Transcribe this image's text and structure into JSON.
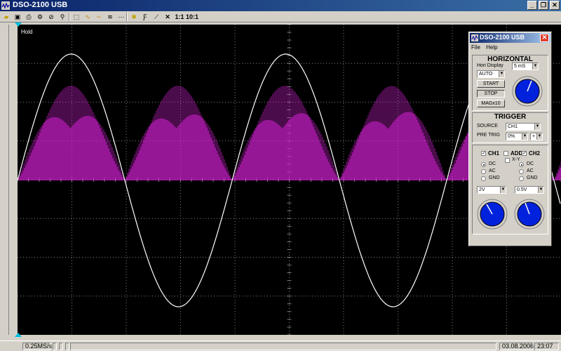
{
  "window": {
    "title": "DSO-2100 USB"
  },
  "toolbar": {
    "ratio1": "1:1",
    "ratio10": "10:1"
  },
  "scope": {
    "status_label": "Hold",
    "colors": {
      "ch1": "#ffffff",
      "ch2": "#d020d0",
      "grid": "#808080",
      "background": "#000000"
    }
  },
  "statusbar": {
    "sample_rate": "0.25MS/s",
    "date": "03.08.2006",
    "time": "23:07"
  },
  "panel": {
    "title": "DSO-2100 USB",
    "menu": [
      "File",
      "Help"
    ],
    "horizontal": {
      "title": "HORIZONTAL",
      "hori_display_label": "Hori Display",
      "hori_display_value": "AUTO",
      "timebase": "5 mS",
      "start_label": "START",
      "stop_label": "STOP",
      "mag_label": "MAGx10"
    },
    "trigger": {
      "title": "TRIGGER",
      "source_label": "SOURCE",
      "source_value": "CH1",
      "pretrig_label": "PRE TRIG",
      "pretrig_value": "0%",
      "slope_value": "+"
    },
    "vertical": {
      "ch1_label": "CH1",
      "add_label": "ADD",
      "xy_label": "X-Y",
      "ch2_label": "CH2",
      "coupling": [
        "DC",
        "AC",
        "GND"
      ],
      "ch1_coupling": "DC",
      "ch2_coupling": "DC",
      "ch1_volts": "2V",
      "ch2_volts": "0.5V"
    }
  }
}
